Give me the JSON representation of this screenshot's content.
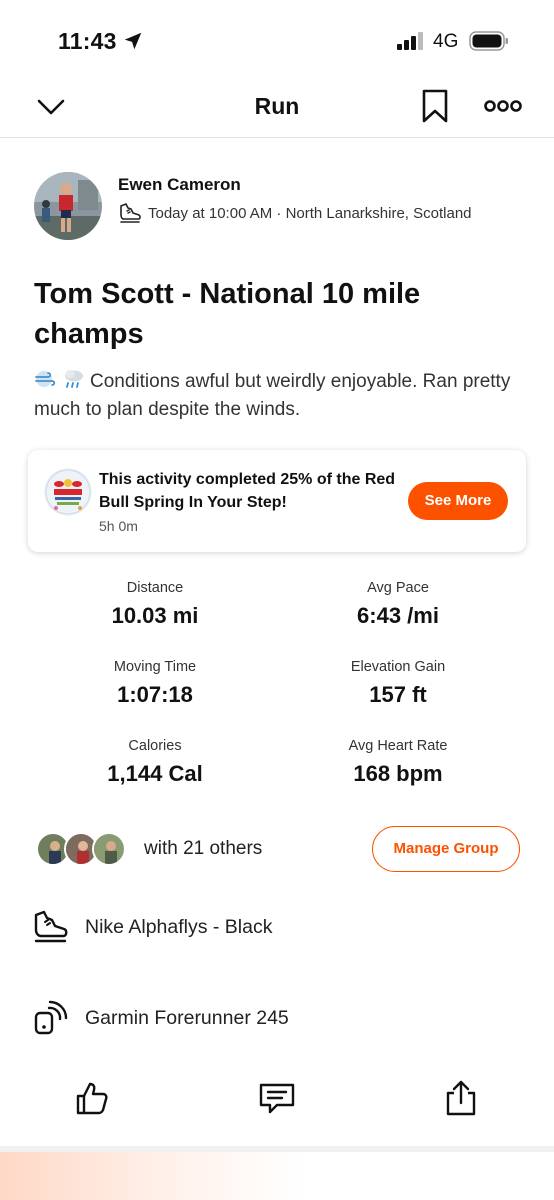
{
  "status_bar": {
    "time": "11:43",
    "network": "4G",
    "icons": [
      "location-arrow-icon",
      "signal-icon",
      "battery-icon"
    ]
  },
  "nav": {
    "title": "Run",
    "icons": [
      "chevron-down-icon",
      "bookmark-icon",
      "more-icon"
    ]
  },
  "athlete": {
    "name": "Ewen Cameron",
    "meta": "Today at 10:00 AM · North Lanarkshire, Scotland",
    "meta_icon": "running-shoe-icon"
  },
  "activity": {
    "title": "Tom Scott - National 10 mile champs",
    "description": "Conditions awful but weirdly enjoyable. Ran pretty much to plan despite the winds.",
    "emojis": [
      "wind-emoji",
      "rain-cloud-emoji"
    ]
  },
  "challenge": {
    "text": "This activity completed 25% of the Red Bull Spring In Your Step!",
    "time": "5h 0m",
    "button": "See More",
    "logo_text": "Red Bull"
  },
  "stats": [
    {
      "label": "Distance",
      "value": "10.03 mi"
    },
    {
      "label": "Avg Pace",
      "value": "6:43 /mi"
    },
    {
      "label": "Moving Time",
      "value": "1:07:18"
    },
    {
      "label": "Elevation Gain",
      "value": "157 ft"
    },
    {
      "label": "Calories",
      "value": "1,144 Cal"
    },
    {
      "label": "Avg Heart Rate",
      "value": "168 bpm"
    }
  ],
  "group": {
    "text": "with 21 others",
    "button": "Manage Group"
  },
  "gear": {
    "shoes": "Nike Alphaflys - Black",
    "device": "Garmin Forerunner 245"
  },
  "actions": [
    "thumbs-up-icon",
    "comment-icon",
    "share-icon"
  ],
  "colors": {
    "accent": "#fc5200",
    "text": "#111111",
    "divider": "#e2e2e2"
  }
}
